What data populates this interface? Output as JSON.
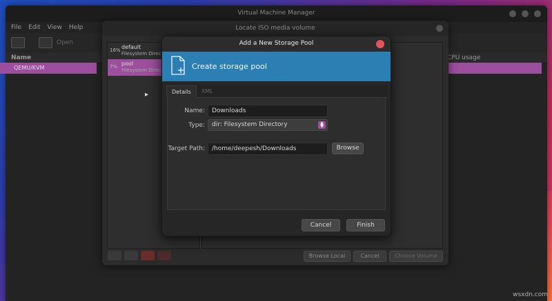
{
  "main_window": {
    "title": "Virtual Machine Manager",
    "menu": [
      "File",
      "Edit",
      "View",
      "Help"
    ],
    "toolbar_open": "Open",
    "col_name": "Name",
    "col_cpu": "CPU usage",
    "vm_name": "QEMU/KVM"
  },
  "iso_dialog": {
    "title": "Locate ISO media volume",
    "pools": [
      {
        "pct": "16%",
        "name": "default",
        "type": "Filesystem Directory"
      },
      {
        "pct": "7%",
        "name": "pool",
        "type": "Filesystem Directory"
      }
    ],
    "browse_local": "Browse Local",
    "cancel": "Cancel",
    "choose_volume": "Choose Volume"
  },
  "pool_dialog": {
    "title": "Add a New Storage Pool",
    "banner": "Create storage pool",
    "tabs": [
      "Details",
      "XML"
    ],
    "name_label": "Name:",
    "name_value": "Downloads",
    "type_label": "Type:",
    "type_value": "dir: Filesystem Directory",
    "target_label": "Target Path:",
    "target_value": "/home/deepesh/Downloads",
    "browse": "Browse",
    "cancel": "Cancel",
    "finish": "Finish",
    "colors": {
      "banner": "#2b7fb3",
      "selection": "#9c4f9c",
      "close": "#e0555a"
    }
  },
  "watermark": "wsxdn.com"
}
